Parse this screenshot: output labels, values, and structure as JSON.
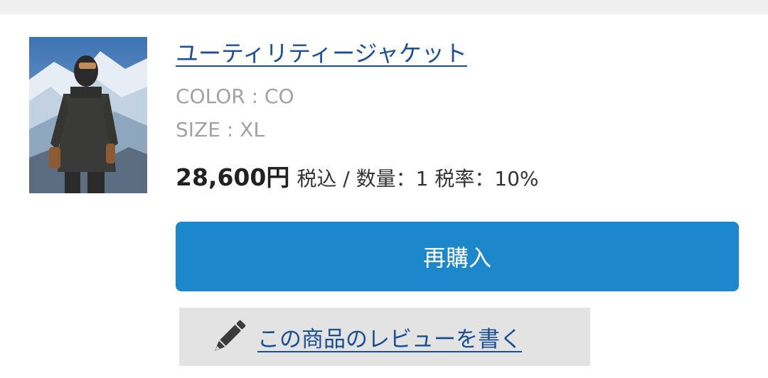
{
  "product": {
    "image_alt": "product-photo-person-in-black-jacket-snowy-mountains",
    "title": "ユーティリティージャケット",
    "color_text": "COLOR : CO",
    "size_text": "SIZE : XL",
    "price": "28,600円",
    "price_meta": "税込 / 数量：1 税率：10%"
  },
  "actions": {
    "rebuy_label": "再購入",
    "review_label": "この商品のレビューを書く",
    "review_icon": "pencil-icon"
  },
  "colors": {
    "link": "#1a4f95",
    "button": "#1d87cc",
    "review_bg": "#e3e3e3",
    "muted": "#a2a2a2"
  }
}
